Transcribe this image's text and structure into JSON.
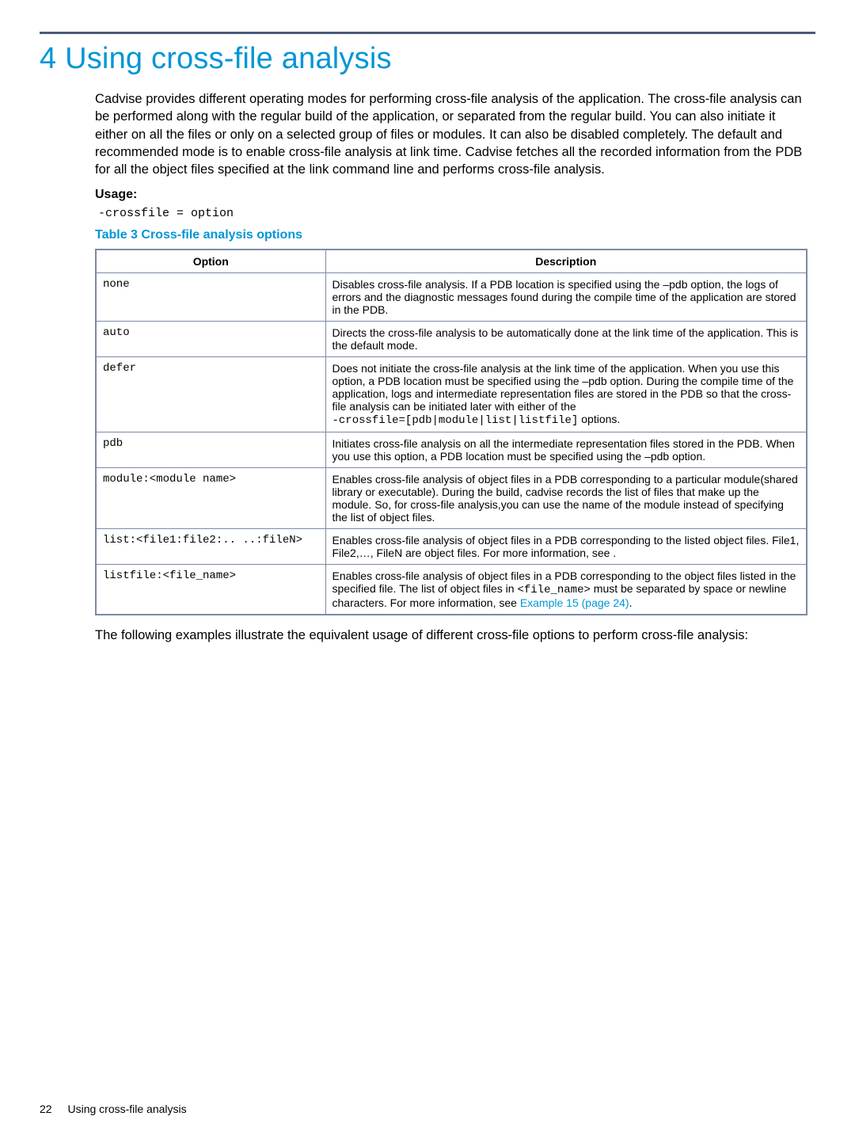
{
  "chapter": {
    "title": "4 Using cross-file analysis"
  },
  "intro": "Cadvise provides different operating modes for performing cross-file analysis of the application. The cross-file analysis can be performed along with the regular build of the application, or separated from the regular build. You can also initiate it either on all the files or only on a selected group of files or modules. It can also be disabled completely. The default and recommended mode is to enable cross-file analysis at link time. Cadvise fetches all the recorded information from the PDB for all the object files specified at the link command line and performs cross-file analysis.",
  "usage": {
    "label": "Usage:",
    "command": "-crossfile = option"
  },
  "table": {
    "title": "Table 3 Cross-file analysis options",
    "headers": {
      "option": "Option",
      "description": "Description"
    },
    "rows": [
      {
        "option": "none",
        "desc": "Disables cross-file analysis. If a PDB location is specified using the –pdb option, the logs of errors and the diagnostic messages found during the compile time of the application are stored in the PDB."
      },
      {
        "option": "auto",
        "desc": "Directs the cross-file analysis to be automatically done at the link time of the application. This is the default mode."
      },
      {
        "option": "defer",
        "desc_pre": "Does not initiate the cross-file analysis at the link time of the application. When you use this option, a PDB location must be specified using the –pdb option. During the compile time of the application, logs and intermediate representation files are stored in the PDB so that the cross-file analysis can be initiated later with either of the",
        "desc_code": "-crossfile=[pdb|module|list|listfile]",
        "desc_post": " options."
      },
      {
        "option": "pdb",
        "desc": "Initiates cross-file analysis on all the intermediate representation files stored in the PDB. When you use this option, a PDB location must be specified using the –pdb option."
      },
      {
        "option": "module:<module name>",
        "desc": "Enables cross-file analysis of object files in a PDB corresponding to a particular module(shared library or executable). During the build, cadvise records the list of files that make up the module. So, for cross-file analysis,you can use the name of the module instead of specifying the list of object files."
      },
      {
        "option": "list:<file1:file2:.. ..:fileN>",
        "desc": "Enables cross-file analysis of object files in a PDB corresponding to the listed object files. File1, File2,…, FileN are object files. For more information, see .",
        "desc_pre": "Enables cross-file analysis of object files in a PDB corresponding to the listed object files. File1, File2,…, FileN are object files. For more information, see ",
        "desc_post": "."
      },
      {
        "option": "listfile:<file_name>",
        "desc_pre": "Enables cross-file analysis of object files in a PDB corresponding to the object files listed in the specified file. The list of object files in ",
        "desc_code": "<file_name>",
        "desc_mid": " must be separated by space or newline characters. For more information, see ",
        "link": "Example 15 (page 24)",
        "desc_post": "."
      }
    ]
  },
  "after": "The following examples illustrate the equivalent usage of different cross-file options to perform cross-file analysis:",
  "footer": {
    "page": "22",
    "section": "Using cross-file analysis"
  }
}
